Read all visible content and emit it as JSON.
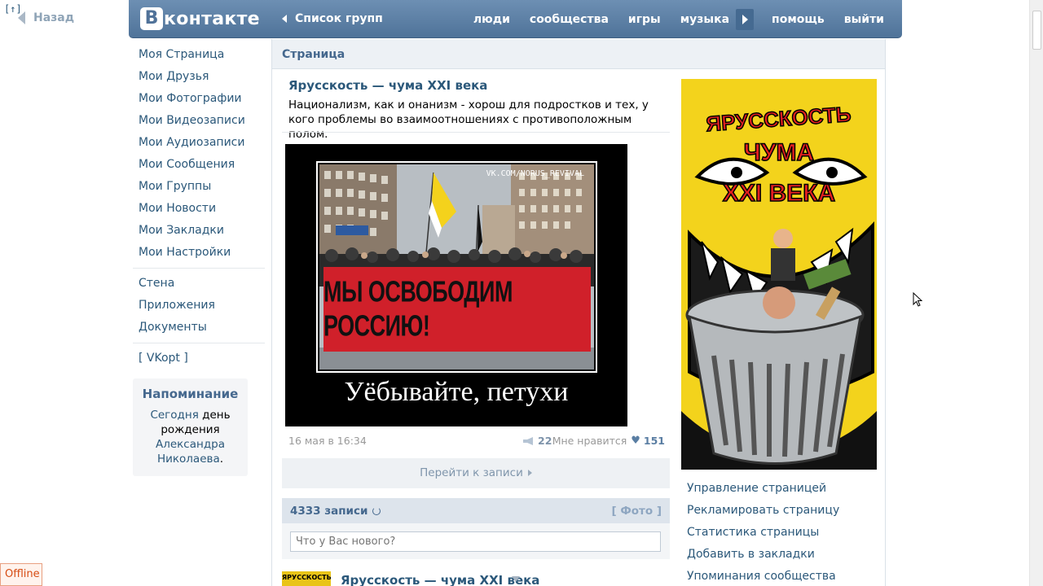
{
  "nav": {
    "up_label": "[↑]",
    "back_label": "Назад"
  },
  "header": {
    "logo_box": "В",
    "logo_text": "контакте",
    "groups_link": "Список групп",
    "menu": [
      "люди",
      "сообщества",
      "игры",
      "музыка",
      "помощь",
      "выйти"
    ],
    "brand_color": "#5b7fa6"
  },
  "leftmenu": {
    "group1": [
      "Моя Страница",
      "Мои Друзья",
      "Мои Фотографии",
      "Мои Видеозаписи",
      "Мои Аудиозаписи",
      "Мои Сообщения",
      "Мои Группы",
      "Мои Новости",
      "Мои Закладки",
      "Мои Настройки"
    ],
    "group2": [
      "Стена",
      "Приложения",
      "Документы"
    ],
    "group3": [
      "[ VKopt ]"
    ]
  },
  "reminder": {
    "title": "Напоминание",
    "today": "Сегодня",
    "text1": " день рождения ",
    "person": "Александра Николаева",
    "dot": "."
  },
  "main": {
    "page_header": "Страница",
    "post": {
      "title": "Ярусскость — чума XXI века",
      "text": "Национализм, как и онанизм - хорош для подростков и тех, у кого проблемы во взаимоотношениях с противоположным полом.",
      "image": {
        "watermark": "VK.COM/NORUS_REVIVAL",
        "banner": "МЫ ОСВОБОДИМ РОССИЮ!",
        "caption": "Уёбывайте, петухи"
      },
      "date": "16 мая в 16:34",
      "shares": "22",
      "likes_label": "Мне нравится",
      "likes": "151",
      "goto_label": "Перейти к записи"
    },
    "wall": {
      "count_label": "4333 записи",
      "photo_filter": "[ Фото ]",
      "input_placeholder": "Что у Вас нового?"
    },
    "next_post": {
      "author": "Ярусскость — чума XXI века",
      "avatar_text": "ЯРУССКОСТЬ"
    }
  },
  "right": {
    "avatar_text": [
      "ЯРУССКОСТЬ",
      "ЧУМА",
      "XXI ВЕКА"
    ],
    "links": [
      "Управление страницей",
      "Рекламировать страницу",
      "Статистика страницы",
      "Добавить в закладки",
      "Упоминания сообщества"
    ]
  },
  "status": {
    "offline": "Offline"
  }
}
